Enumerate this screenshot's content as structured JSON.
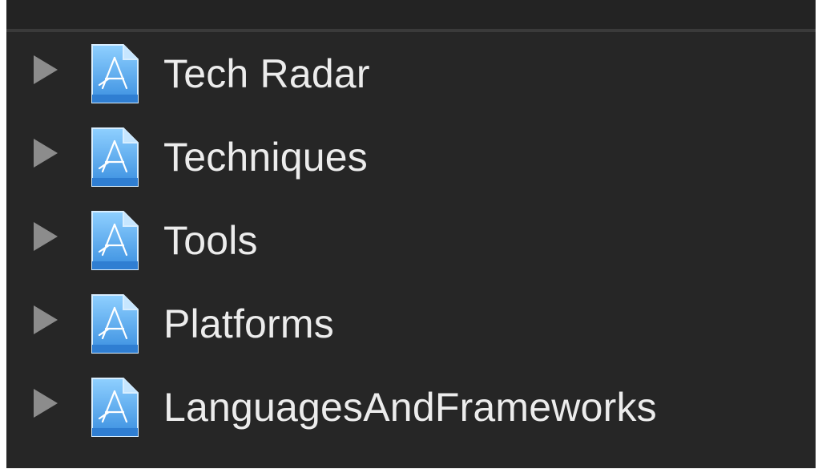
{
  "navigator": {
    "items": [
      {
        "label": "Tech Radar",
        "icon": "xcode-project-icon",
        "expanded": false
      },
      {
        "label": "Techniques",
        "icon": "xcode-project-icon",
        "expanded": false
      },
      {
        "label": "Tools",
        "icon": "xcode-project-icon",
        "expanded": false
      },
      {
        "label": "Platforms",
        "icon": "xcode-project-icon",
        "expanded": false
      },
      {
        "label": "LanguagesAndFrameworks",
        "icon": "xcode-project-icon",
        "expanded": false
      }
    ]
  },
  "colors": {
    "background": "#262626",
    "text": "#ececec",
    "disclosure": "#8c8c8c",
    "icon_blue": "#4aa8ef"
  }
}
